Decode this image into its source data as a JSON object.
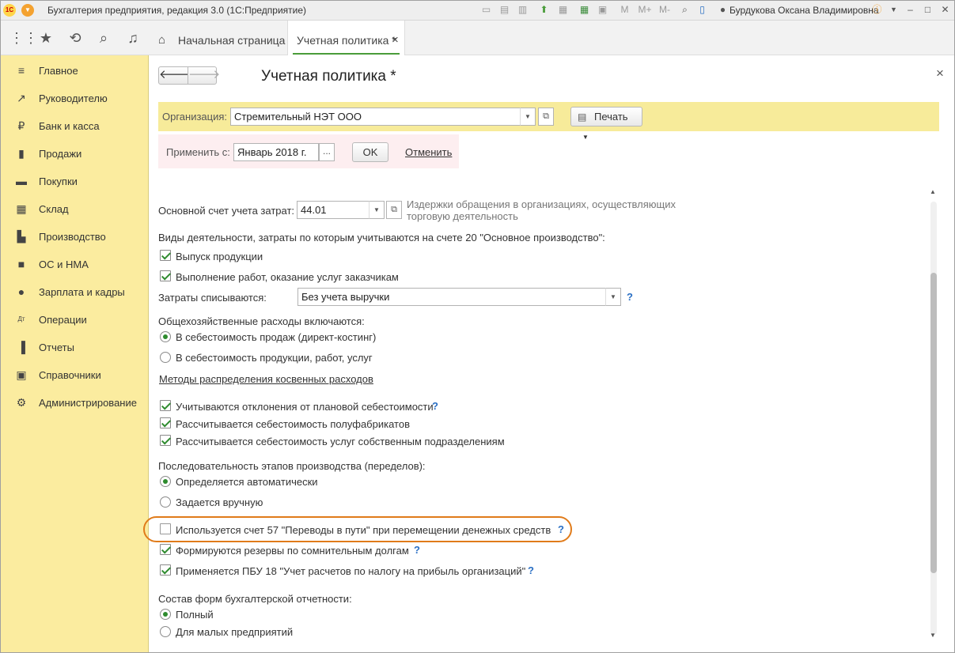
{
  "titlebar": {
    "title": "Бухгалтерия предприятия, редакция 3.0  (1С:Предприятие)",
    "user": "Бурдукова Оксана Владимировна",
    "tools": [
      "M",
      "M+",
      "M-"
    ]
  },
  "tabs": [
    {
      "label": "Начальная страница"
    },
    {
      "label": "Учетная политика *",
      "close": "×"
    }
  ],
  "sidebar": {
    "items": [
      {
        "label": "Главное",
        "icon": "≡"
      },
      {
        "label": "Руководителю",
        "icon": "↗"
      },
      {
        "label": "Банк и касса",
        "icon": "₽"
      },
      {
        "label": "Продажи",
        "icon": "▮"
      },
      {
        "label": "Покупки",
        "icon": "▬"
      },
      {
        "label": "Склад",
        "icon": "▦"
      },
      {
        "label": "Производство",
        "icon": "▙"
      },
      {
        "label": "ОС и НМА",
        "icon": "■"
      },
      {
        "label": "Зарплата и кадры",
        "icon": "●"
      },
      {
        "label": "Операции",
        "icon": "Дт"
      },
      {
        "label": "Отчеты",
        "icon": "▐"
      },
      {
        "label": "Справочники",
        "icon": "▣"
      },
      {
        "label": "Администрирование",
        "icon": "⚙"
      }
    ]
  },
  "form": {
    "title": "Учетная политика *",
    "close": "×",
    "org_label": "Организация:",
    "org_value": "Стремительный НЭТ ООО",
    "print_label": "Печать",
    "apply_label": "Применить с:",
    "apply_value": "Январь 2018 г.",
    "apply_more": "...",
    "ok_label": "OK",
    "cancel_label": "Отменить",
    "account_label": "Основной счет учета затрат:",
    "account_value": "44.01",
    "account_desc1": "Издержки обращения в организациях, осуществляющих",
    "account_desc2": "торговую деятельность",
    "activities_label": "Виды деятельности, затраты по которым учитываются на счете 20 \"Основное производство\":",
    "cb_release": "Выпуск продукции",
    "cb_works": "Выполнение работ, оказание услуг заказчикам",
    "writeoff_label": "Затраты списываются:",
    "writeoff_value": "Без учета выручки",
    "overhead_label": "Общехозяйственные расходы включаются:",
    "rb_direct": "В себестоимость продаж (директ-костинг)",
    "rb_cost": "В  себестоимость продукции, работ, услуг",
    "methods_link": "Методы распределения косвенных расходов",
    "cb_deviation": "Учитываются отклонения от плановой себестоимости",
    "cb_semi": "Рассчитывается себестоимость полуфабрикатов",
    "cb_services": "Рассчитывается себестоимость услуг собственным подразделениям",
    "sequence_label": "Последовательность этапов производства (переделов):",
    "rb_auto": "Определяется автоматически",
    "rb_manual": "Задается вручную",
    "cb_account57": "Используется счет 57 \"Переводы в пути\" при перемещении денежных средств",
    "cb_reserves": "Формируются резервы по сомнительным долгам",
    "cb_pbu18": "Применяется ПБУ 18 \"Учет расчетов по налогу на прибыль организаций\"",
    "forms_label": "Состав форм бухгалтерской отчетности:",
    "rb_full": "Полный",
    "rb_small": "Для малых предприятий",
    "help": "?"
  },
  "colors": {
    "sidebar": "#fbec9f",
    "org_band": "#f7eb9a",
    "apply_band": "#fdeef0",
    "highlight": "#e07b1a",
    "check": "#2e8b2e"
  }
}
